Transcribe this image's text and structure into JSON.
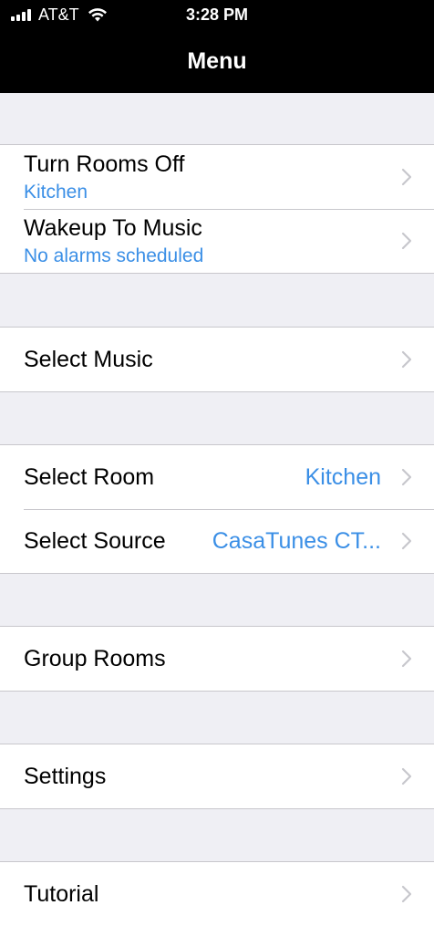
{
  "status_bar": {
    "carrier": "AT&T",
    "time": "3:28 PM",
    "signal_icon": "cellular-signal-icon",
    "wifi_icon": "wifi-icon"
  },
  "nav": {
    "title": "Menu"
  },
  "menu": {
    "turn_rooms_off": {
      "title": "Turn Rooms Off",
      "subtitle": "Kitchen"
    },
    "wakeup_to_music": {
      "title": "Wakeup To Music",
      "subtitle": "No alarms scheduled"
    },
    "select_music": {
      "title": "Select Music"
    },
    "select_room": {
      "title": "Select Room",
      "value": "Kitchen"
    },
    "select_source": {
      "title": "Select Source",
      "value": "CasaTunes CT..."
    },
    "group_rooms": {
      "title": "Group Rooms"
    },
    "settings": {
      "title": "Settings"
    },
    "tutorial": {
      "title": "Tutorial"
    }
  },
  "colors": {
    "accent": "#3b8fe6",
    "background": "#efeff4",
    "separator": "#c8c7cc",
    "navbar": "#000000",
    "chevron": "#c7c7cc"
  }
}
